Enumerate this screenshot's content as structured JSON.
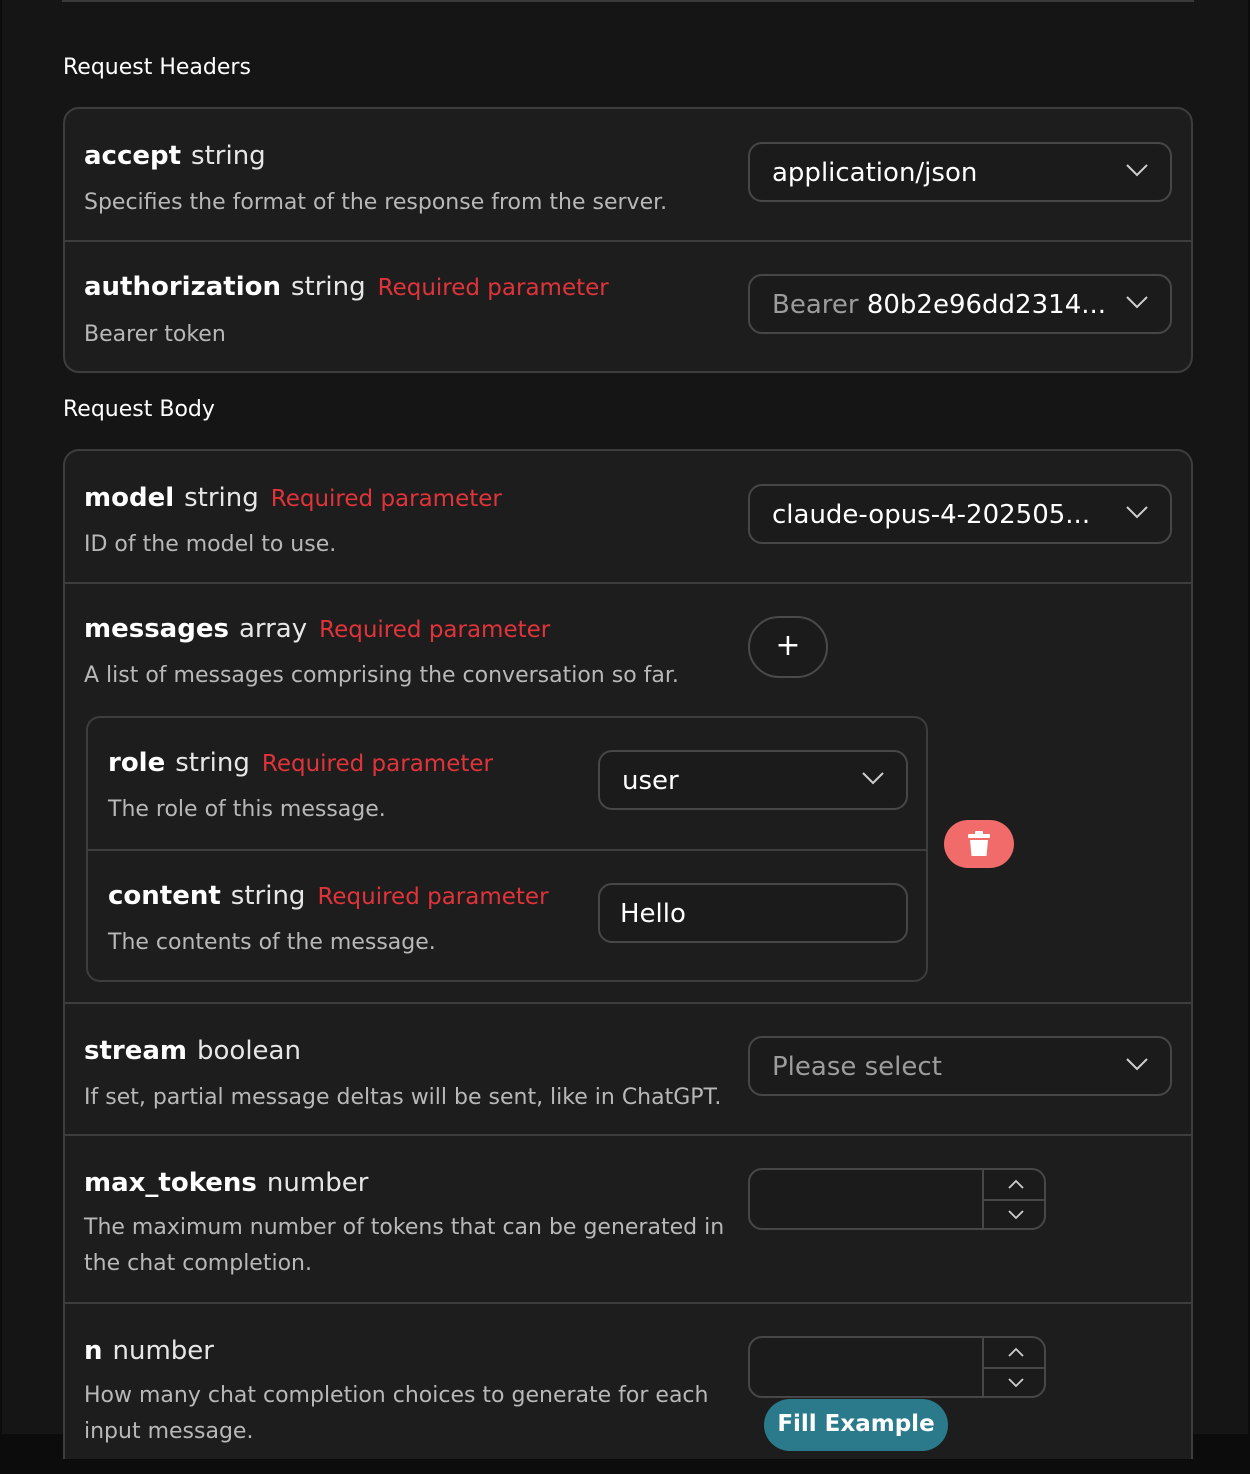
{
  "sections": {
    "headers_title": "Request Headers",
    "body_title": "Request Body"
  },
  "headers": {
    "accept": {
      "name": "accept",
      "type": "string",
      "description": "Specifies the format of the response from the server.",
      "value": "application/json"
    },
    "authorization": {
      "name": "authorization",
      "type": "string",
      "required": "Required parameter",
      "description": "Bearer token",
      "prefix": "Bearer",
      "value": "80b2e96dd2314..."
    }
  },
  "body": {
    "model": {
      "name": "model",
      "type": "string",
      "required": "Required parameter",
      "description": "ID of the model to use.",
      "value": "claude-opus-4-202505..."
    },
    "messages": {
      "name": "messages",
      "type": "array",
      "required": "Required parameter",
      "description": "A list of messages comprising the conversation so far.",
      "add_label": "+",
      "role": {
        "name": "role",
        "type": "string",
        "required": "Required parameter",
        "description": "The role of this message.",
        "value": "user"
      },
      "content": {
        "name": "content",
        "type": "string",
        "required": "Required parameter",
        "description": "The contents of the message.",
        "value": "Hello"
      }
    },
    "stream": {
      "name": "stream",
      "type": "boolean",
      "description": "If set, partial message deltas will be sent, like in ChatGPT.",
      "placeholder": "Please select"
    },
    "max_tokens": {
      "name": "max_tokens",
      "type": "number",
      "description_line1": "The maximum number of tokens that can be generated in",
      "description_line2": "the chat completion."
    },
    "n": {
      "name": "n",
      "type": "number",
      "description_line1": "How many chat completion choices to generate for each",
      "description_line2": "input message."
    }
  },
  "fill_example_label": "Fill Example",
  "colors": {
    "required": "#e0343a",
    "delete": "#f26b6b",
    "fill": "#2b7a8c"
  },
  "icons": [
    "chevron-down-icon",
    "chevron-up-icon",
    "plus-icon",
    "trash-icon"
  ]
}
